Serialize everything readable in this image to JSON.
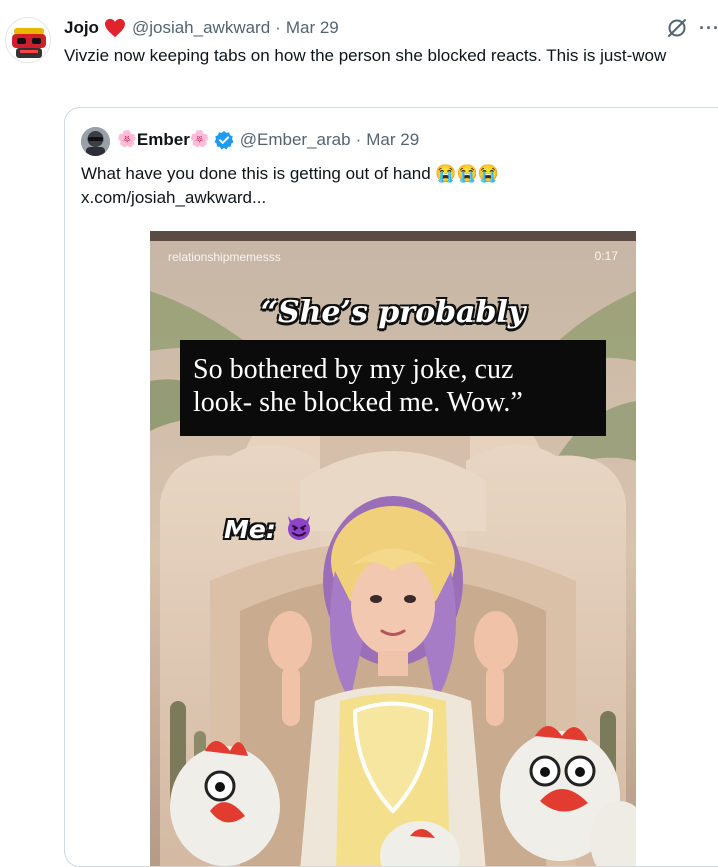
{
  "tweet": {
    "author_name": "Jojo",
    "handle": "@josiah_awkward",
    "separator": "·",
    "date": "Mar 29",
    "more_label": "···",
    "text": "Vivzie now keeping tabs on how the person she blocked reacts. This is just-wow"
  },
  "quote": {
    "flower_left": "🌸",
    "author_name": "Ember",
    "flower_right": "🌸",
    "handle": "@Ember_arab",
    "separator": "·",
    "date": "Mar 29",
    "text": "What have you done this is getting out of hand 😭😭😭",
    "link": "x.com/josiah_awkward..."
  },
  "media": {
    "watermark": "relationshipmemesss",
    "timestamp": "0:17",
    "caption_title": "“She’s probably",
    "caption_line1": "So bothered by my joke, cuz",
    "caption_line2": "look- she blocked me. Wow.”",
    "me_label": "Me:"
  },
  "colors": {
    "accent": "#1d9bf0",
    "heart": "#f91880",
    "muted_text": "#536471",
    "border": "#cfd9de"
  },
  "icons": [
    "heart-icon",
    "grok-icon",
    "more-icon",
    "verified-badge-icon",
    "devil-emoji-icon"
  ]
}
